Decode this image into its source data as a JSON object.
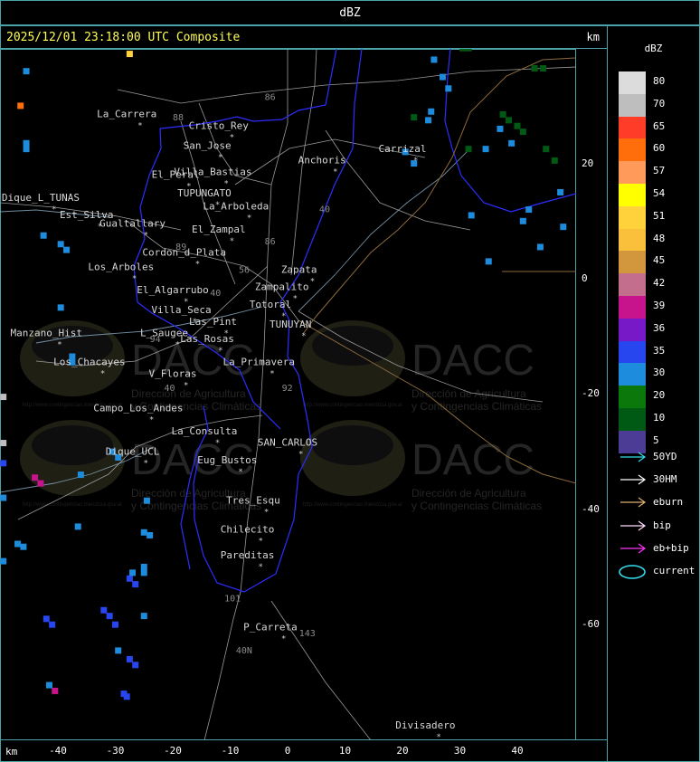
{
  "header": {
    "title": "dBZ",
    "timestamp": "2025/12/01 23:18:00 UTC Composite",
    "km_top": "km",
    "km_bottom": "km"
  },
  "axes": {
    "x_ticks": [
      "-40",
      "-30",
      "-20",
      "-10",
      "0",
      "10",
      "20",
      "30",
      "40"
    ],
    "x_values": [
      -40,
      -30,
      -20,
      -10,
      0,
      10,
      20,
      30,
      40
    ],
    "y_ticks": [
      "20",
      "0",
      "-20",
      "-40",
      "-60"
    ],
    "y_values": [
      20,
      0,
      -20,
      -40,
      -60
    ],
    "x_range": [
      -50,
      50
    ],
    "y_range": [
      -80,
      40
    ]
  },
  "places": [
    {
      "name": "La_Carrera",
      "x": -28,
      "y": 28
    },
    {
      "name": "Cristo_Rey",
      "x": -12,
      "y": 26
    },
    {
      "name": "San_Jose",
      "x": -14,
      "y": 22.5
    },
    {
      "name": "Villa_Bastias",
      "x": -13,
      "y": 18
    },
    {
      "name": "El_Peral",
      "x": -19.5,
      "y": 17.5
    },
    {
      "name": "Anchoris",
      "x": 6,
      "y": 20
    },
    {
      "name": "Carrizal",
      "x": 20,
      "y": 22
    },
    {
      "name": "Dique_L_TUNAS",
      "x": -43,
      "y": 13.5
    },
    {
      "name": "TUPUNGATO",
      "x": -14.5,
      "y": 14.3
    },
    {
      "name": "La_Arboleda",
      "x": -9,
      "y": 12
    },
    {
      "name": "Est_Silva",
      "x": -35,
      "y": 10.5
    },
    {
      "name": "Gualtallary",
      "x": -27,
      "y": 9
    },
    {
      "name": "El_Zampal",
      "x": -12,
      "y": 8
    },
    {
      "name": "Cordon_d_Plata",
      "x": -18,
      "y": 4
    },
    {
      "name": "Los_Arboles",
      "x": -29,
      "y": 1.5
    },
    {
      "name": "Zapata",
      "x": 2,
      "y": 1
    },
    {
      "name": "El_Algarrubo",
      "x": -20,
      "y": -2.5
    },
    {
      "name": "Zampalito",
      "x": -1,
      "y": -2
    },
    {
      "name": "Totoral",
      "x": -3,
      "y": -5
    },
    {
      "name": "Villa_Seca",
      "x": -18.5,
      "y": -6
    },
    {
      "name": "TUNUYAN",
      "x": 0.5,
      "y": -8.5
    },
    {
      "name": "Las_Pint",
      "x": -13,
      "y": -8
    },
    {
      "name": "Manzano_Hist",
      "x": -42,
      "y": -10
    },
    {
      "name": "L_Saugee",
      "x": -21.5,
      "y": -10
    },
    {
      "name": "Las_Rosas",
      "x": -14,
      "y": -11
    },
    {
      "name": "Los_Chacayes",
      "x": -34.5,
      "y": -15
    },
    {
      "name": "La_Primavera",
      "x": -5,
      "y": -15
    },
    {
      "name": "V_Floras",
      "x": -20,
      "y": -17
    },
    {
      "name": "Campo_Los_Andes",
      "x": -26,
      "y": -23
    },
    {
      "name": "La_Consulta",
      "x": -14.5,
      "y": -27
    },
    {
      "name": "SAN_CARLOS",
      "x": 0,
      "y": -29
    },
    {
      "name": "Dique_UCL",
      "x": -27,
      "y": -30.5
    },
    {
      "name": "Eug_Bustos",
      "x": -10.5,
      "y": -32
    },
    {
      "name": "Tres_Esqu",
      "x": -6,
      "y": -39
    },
    {
      "name": "Chilecito",
      "x": -7,
      "y": -44
    },
    {
      "name": "Pareditas",
      "x": -7,
      "y": -48.5
    },
    {
      "name": "P_Carreta",
      "x": -3,
      "y": -61
    },
    {
      "name": "Divisadero",
      "x": 24,
      "y": -78
    }
  ],
  "road_labels": [
    "88",
    "86",
    "40",
    "86",
    "56",
    "89",
    "40",
    "94",
    "40",
    "92",
    "101",
    "143",
    "40N"
  ],
  "radar_cells": [
    {
      "x": -27.5,
      "y": 39,
      "dbz": 51
    },
    {
      "x": -46.5,
      "y": 30,
      "dbz": 60
    },
    {
      "x": -49.5,
      "y": -20.5,
      "dbz": 70
    },
    {
      "x": -49.5,
      "y": -28.5,
      "dbz": 70
    },
    {
      "x": -49.5,
      "y": -32,
      "dbz": 35
    },
    {
      "x": -44,
      "y": -34.5,
      "dbz": 39
    },
    {
      "x": -43,
      "y": -35.5,
      "dbz": 39
    },
    {
      "x": -40.5,
      "y": -71.5,
      "dbz": 39
    },
    {
      "x": -41.5,
      "y": -70.5,
      "dbz": 30
    },
    {
      "x": -42,
      "y": -59,
      "dbz": 35
    },
    {
      "x": -41,
      "y": -60,
      "dbz": 35
    },
    {
      "x": -32,
      "y": -57.5,
      "dbz": 35
    },
    {
      "x": -31,
      "y": -58.5,
      "dbz": 35
    },
    {
      "x": -30,
      "y": -60,
      "dbz": 35
    },
    {
      "x": -27.5,
      "y": -52,
      "dbz": 35
    },
    {
      "x": -26.5,
      "y": -53,
      "dbz": 35
    },
    {
      "x": -27.5,
      "y": -66,
      "dbz": 35
    },
    {
      "x": -26.5,
      "y": -67,
      "dbz": 35
    },
    {
      "x": -28.5,
      "y": -72,
      "dbz": 35
    },
    {
      "x": -28,
      "y": -72.5,
      "dbz": 35
    },
    {
      "x": -27,
      "y": -51,
      "dbz": 30
    },
    {
      "x": -25,
      "y": -51,
      "dbz": 30
    },
    {
      "x": -25,
      "y": -50,
      "dbz": 30
    },
    {
      "x": -25,
      "y": -58.5,
      "dbz": 30
    },
    {
      "x": -29.5,
      "y": -64.5,
      "dbz": 30
    },
    {
      "x": -49.5,
      "y": -49,
      "dbz": 30
    },
    {
      "x": -47,
      "y": -46,
      "dbz": 30
    },
    {
      "x": -46,
      "y": -46.5,
      "dbz": 30
    },
    {
      "x": -36.5,
      "y": -43,
      "dbz": 30
    },
    {
      "x": -25,
      "y": -44,
      "dbz": 30
    },
    {
      "x": -24,
      "y": -44.5,
      "dbz": 30
    },
    {
      "x": -24.5,
      "y": -38.5,
      "dbz": 30
    },
    {
      "x": -36,
      "y": -34,
      "dbz": 30
    },
    {
      "x": -30.5,
      "y": -30,
      "dbz": 30
    },
    {
      "x": -29.5,
      "y": -31,
      "dbz": 30
    },
    {
      "x": -37.5,
      "y": -13.5,
      "dbz": 30
    },
    {
      "x": -37.5,
      "y": -14.5,
      "dbz": 30
    },
    {
      "x": -49.5,
      "y": -38,
      "dbz": 30
    },
    {
      "x": -45.5,
      "y": 36,
      "dbz": 30
    },
    {
      "x": -45.5,
      "y": 23.5,
      "dbz": 30
    },
    {
      "x": -45.5,
      "y": 22.5,
      "dbz": 30
    },
    {
      "x": -42.5,
      "y": 7.5,
      "dbz": 30
    },
    {
      "x": -39.5,
      "y": 6,
      "dbz": 30
    },
    {
      "x": -38.5,
      "y": 5,
      "dbz": 30
    },
    {
      "x": -39.5,
      "y": -5,
      "dbz": 30
    },
    {
      "x": 25.5,
      "y": 38,
      "dbz": 30
    },
    {
      "x": 27,
      "y": 35,
      "dbz": 30
    },
    {
      "x": 28,
      "y": 33,
      "dbz": 30
    },
    {
      "x": 25,
      "y": 29,
      "dbz": 30
    },
    {
      "x": 24.5,
      "y": 27.5,
      "dbz": 30
    },
    {
      "x": 20.5,
      "y": 22,
      "dbz": 30
    },
    {
      "x": 22,
      "y": 20,
      "dbz": 30
    },
    {
      "x": 34.5,
      "y": 22.5,
      "dbz": 30
    },
    {
      "x": 37,
      "y": 26,
      "dbz": 30
    },
    {
      "x": 39,
      "y": 23.5,
      "dbz": 30
    },
    {
      "x": 47.5,
      "y": 15,
      "dbz": 30
    },
    {
      "x": 32,
      "y": 11,
      "dbz": 30
    },
    {
      "x": 42,
      "y": 12,
      "dbz": 30
    },
    {
      "x": 41,
      "y": 10,
      "dbz": 30
    },
    {
      "x": 48,
      "y": 9,
      "dbz": 30
    },
    {
      "x": 44,
      "y": 5.5,
      "dbz": 30
    },
    {
      "x": 35,
      "y": 3,
      "dbz": 30
    },
    {
      "x": 31.5,
      "y": 40,
      "dbz": 10
    },
    {
      "x": 30.5,
      "y": 40,
      "dbz": 10
    },
    {
      "x": 43,
      "y": 36.5,
      "dbz": 10
    },
    {
      "x": 44.5,
      "y": 36.5,
      "dbz": 10
    },
    {
      "x": 37.5,
      "y": 28.5,
      "dbz": 10
    },
    {
      "x": 38.5,
      "y": 27.5,
      "dbz": 10
    },
    {
      "x": 40,
      "y": 26.5,
      "dbz": 10
    },
    {
      "x": 41,
      "y": 25.5,
      "dbz": 10
    },
    {
      "x": 22,
      "y": 28,
      "dbz": 10
    },
    {
      "x": 31.5,
      "y": 22.5,
      "dbz": 10
    },
    {
      "x": 45,
      "y": 22.5,
      "dbz": 10
    },
    {
      "x": 46.5,
      "y": 20.5,
      "dbz": 10
    }
  ],
  "legend": {
    "title": "dBZ",
    "levels": [
      {
        "label": "80",
        "color": "#dcdcdc"
      },
      {
        "label": "70",
        "color": "#bebebe"
      },
      {
        "label": "65",
        "color": "#ff3c28"
      },
      {
        "label": "60",
        "color": "#ff6e0a"
      },
      {
        "label": "57",
        "color": "#ff9a5a"
      },
      {
        "label": "54",
        "color": "#ffff00"
      },
      {
        "label": "51",
        "color": "#ffd23c"
      },
      {
        "label": "48",
        "color": "#fac03c"
      },
      {
        "label": "45",
        "color": "#d2963c"
      },
      {
        "label": "42",
        "color": "#c36e8c"
      },
      {
        "label": "39",
        "color": "#c8148c"
      },
      {
        "label": "36",
        "color": "#7819c8"
      },
      {
        "label": "35",
        "color": "#2846f0"
      },
      {
        "label": "30",
        "color": "#1e8cdc"
      },
      {
        "label": "20",
        "color": "#0a780a"
      },
      {
        "label": "10",
        "color": "#005a14"
      },
      {
        "label": "5",
        "color": "#4c3c96"
      }
    ],
    "tracks": [
      {
        "label": "50YD",
        "color": "#33ddee"
      },
      {
        "label": "30HM",
        "color": "#ffffff"
      },
      {
        "label": "eburn",
        "color": "#e0b070"
      },
      {
        "label": "bip",
        "color": "#ffddff"
      },
      {
        "label": "eb+bip",
        "color": "#ff33ff"
      },
      {
        "label": "current",
        "color": "#33ddee"
      }
    ]
  },
  "watermark": {
    "brand": "DACC",
    "line1": "Dirección de Agricultura",
    "line2": "y Contingencias Climáticas",
    "url": "http://www.contingencias.mendoza.gov.ar"
  }
}
